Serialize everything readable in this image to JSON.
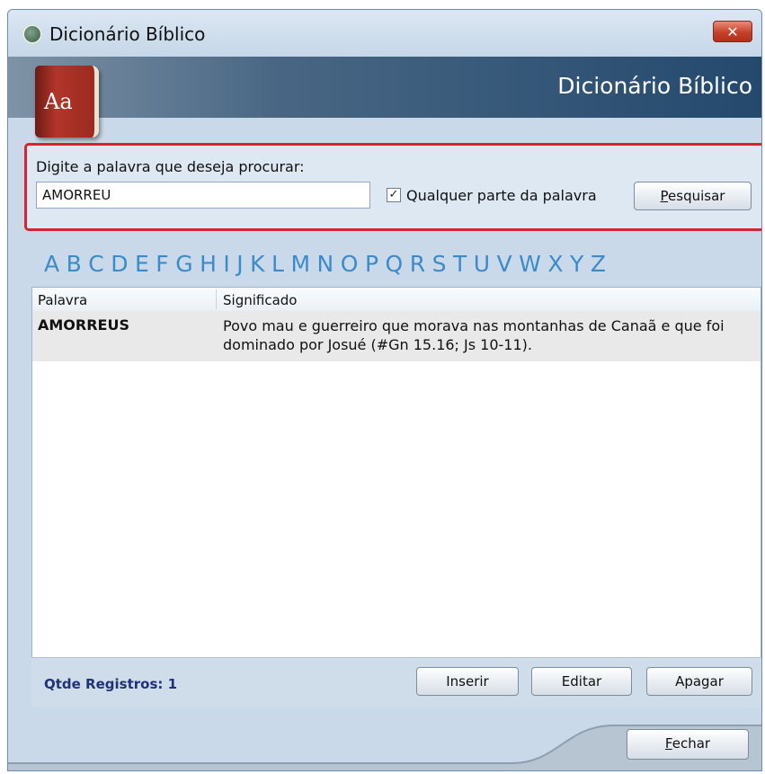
{
  "window": {
    "title": "Dicionário Bíblico",
    "close_icon": "close-icon",
    "app_icon": "app-logo-icon"
  },
  "banner": {
    "title": "Dicionário Bíblico",
    "book_icon_label": "Aa"
  },
  "search": {
    "prompt": "Digite a palavra que deseja procurar:",
    "value": "AMORREU",
    "checkbox_label": "Qualquer parte da palavra",
    "checkbox_checked": true,
    "button_label_accel": "P",
    "button_label_rest": "esquisar"
  },
  "alphabet": [
    "A",
    "B",
    "C",
    "D",
    "E",
    "F",
    "G",
    "H",
    "I",
    "J",
    "K",
    "L",
    "M",
    "N",
    "O",
    "P",
    "Q",
    "R",
    "S",
    "T",
    "U",
    "V",
    "W",
    "X",
    "Y",
    "Z"
  ],
  "table": {
    "columns": [
      "Palavra",
      "Significado"
    ],
    "rows": [
      {
        "palavra": "AMORREUS",
        "significado": "Povo mau e guerreiro que morava nas montanhas de Canaã e que foi dominado por Josué (#Gn 15.16; Js 10-11)."
      }
    ]
  },
  "footer": {
    "count_label": "Qtde Registros: 1",
    "insert_label": "Inserir",
    "edit_label": "Editar",
    "delete_label": "Apagar"
  },
  "bottom": {
    "close_label_accel": "F",
    "close_label_rest": "echar"
  },
  "colors": {
    "accent_red": "#d7232c",
    "alphabet_blue": "#3c8bc9",
    "count_blue": "#1f3178"
  }
}
